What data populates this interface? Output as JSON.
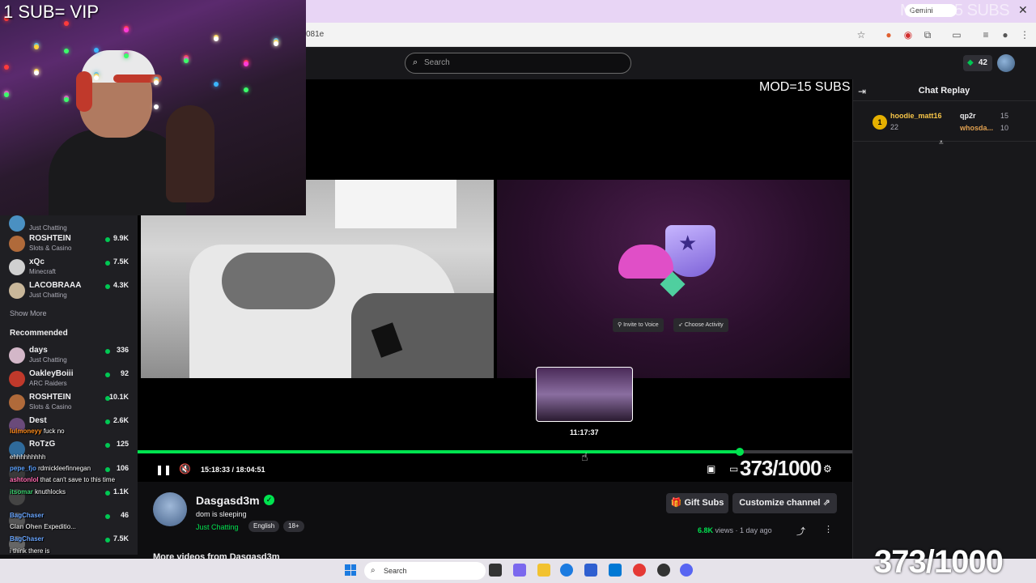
{
  "browser": {
    "url": "081e",
    "gemini_label": "Gemini"
  },
  "overlays": {
    "sub_vip": "1 SUB= VIP",
    "mod_subs": "MOD=15 SUBS",
    "goal_counter": "373/1000"
  },
  "topnav": {
    "search_placeholder": "Search",
    "points": "42"
  },
  "sidebar": {
    "channels": [
      {
        "name": "",
        "category": "Just Chatting",
        "viewers": "",
        "avatar_color": "#4a90c2"
      },
      {
        "name": "ROSHTEIN",
        "category": "Slots & Casino",
        "viewers": "9.9K",
        "avatar_color": "#b06a3a"
      },
      {
        "name": "xQc",
        "category": "Minecraft",
        "viewers": "7.5K",
        "avatar_color": "#d0d0d0"
      },
      {
        "name": "LACOBRAAA",
        "category": "Just Chatting",
        "viewers": "4.3K",
        "avatar_color": "#c9b79a"
      }
    ],
    "show_more": "Show More",
    "recommended_title": "Recommended",
    "recommended": [
      {
        "name": "days",
        "category": "Just Chatting",
        "viewers": "336",
        "avatar_color": "#d3b7c8"
      },
      {
        "name": "OakleyBoiii",
        "category": "ARC Raiders",
        "viewers": "92",
        "avatar_color": "#c0392b"
      },
      {
        "name": "ROSHTEIN",
        "category": "Slots & Casino",
        "viewers": "10.1K",
        "avatar_color": "#b06a3a"
      },
      {
        "name": "Dest",
        "category": "",
        "viewers": "2.6K",
        "avatar_color": "#6a4a7a"
      },
      {
        "name": "RoTzG",
        "category": "",
        "viewers": "125",
        "avatar_color": "#2f6a9a"
      },
      {
        "name": "",
        "category": "",
        "viewers": "106",
        "avatar_color": "#3a3a3a"
      },
      {
        "name": "",
        "category": "",
        "viewers": "1.1K",
        "avatar_color": "#444"
      },
      {
        "name": "",
        "category": "",
        "viewers": "46",
        "avatar_color": "#555"
      },
      {
        "name": "",
        "category": "",
        "viewers": "7.5K",
        "avatar_color": "#666"
      }
    ]
  },
  "stream_chat": [
    {
      "user": "lulmoneyy",
      "text": "fuck no"
    },
    {
      "user": "",
      "text": "ehhhhhhhhh"
    },
    {
      "user": "pepe_fjo",
      "text": "rdmickleefinnegan"
    },
    {
      "user": "ashtonlol",
      "text": "that can't save to this time"
    },
    {
      "user": "itsomar",
      "text": "knuthlocks"
    },
    {
      "user": "BagChaser",
      "text": ""
    },
    {
      "user": "Clan Ohen",
      "text": "Expeditio..."
    },
    {
      "user": "BagChaser",
      "text": ""
    },
    {
      "user": "",
      "text": "i think there is"
    }
  ],
  "player": {
    "voice_invite": "Invite to Voice",
    "choose_activity": "Choose Activity",
    "preview_time": "11:17:37",
    "time_display": "15:18:33 / 18:04:51",
    "progress": 0.843
  },
  "chat_replay": {
    "title": "Chat Replay",
    "leaderboard": [
      {
        "rank": "1",
        "name": "hoodie_matt16",
        "count": "22"
      },
      {
        "rank": "",
        "name": "qp2r",
        "count": "15"
      },
      {
        "rank": "",
        "name": "whosda...",
        "count": "10"
      }
    ]
  },
  "channel": {
    "name": "Dasgasd3m",
    "title": "dom is sleeping",
    "category": "Just Chatting",
    "tags": [
      "English",
      "18+"
    ],
    "gift_label": "Gift Subs",
    "customize_label": "Customize channel",
    "views": "6.8K",
    "views_word": "views",
    "age": "1 day ago",
    "more_videos": "More videos from Dasgasd3m"
  },
  "taskbar": {
    "search_label": "Search"
  },
  "colors": {
    "accent": "#00e34f",
    "background": "#0e0e10",
    "panel": "#18181b"
  }
}
